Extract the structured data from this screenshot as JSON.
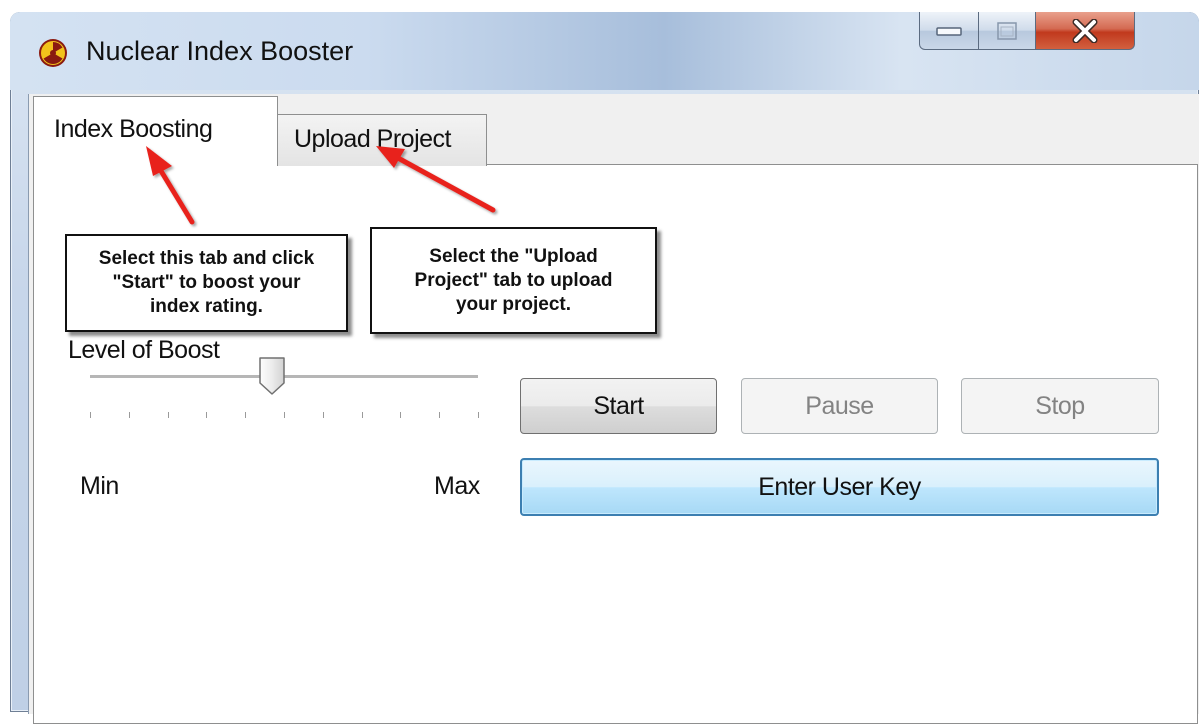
{
  "window": {
    "title": "Nuclear Index Booster"
  },
  "titlebar_buttons": {
    "minimize_icon": "minimize-icon",
    "maximize_icon": "maximize-icon",
    "close_icon": "close-icon"
  },
  "tabs": [
    {
      "label": "Index Boosting",
      "active": true
    },
    {
      "label": "Upload Project",
      "active": false
    }
  ],
  "boost": {
    "label": "Level of Boost",
    "min_label": "Min",
    "max_label": "Max",
    "level_fraction": 0.47,
    "tick_count": 11
  },
  "buttons": {
    "start": "Start",
    "pause": "Pause",
    "stop": "Stop",
    "enter_key": "Enter User Key"
  },
  "callouts": {
    "tab1": "Select this tab and click\n\"Start\" to boost your\nindex rating.",
    "tab2": "Select the \"Upload\nProject\" tab to upload\nyour project."
  },
  "colors": {
    "arrow": "#e8221c",
    "focus_button_border": "#3c7fb1",
    "close_button": "#c1391d"
  }
}
